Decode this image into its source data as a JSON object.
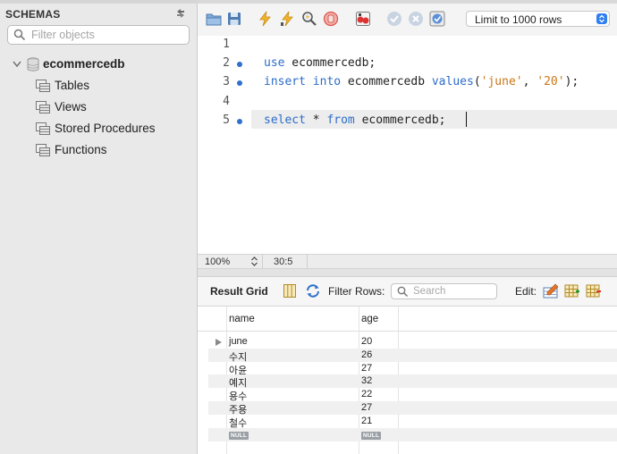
{
  "schemas": {
    "title": "SCHEMAS",
    "filter_placeholder": "Filter objects",
    "database": "ecommercedb",
    "items": [
      {
        "label": "Tables"
      },
      {
        "label": "Views"
      },
      {
        "label": "Stored Procedures"
      },
      {
        "label": "Functions"
      }
    ]
  },
  "toolbar": {
    "icons": [
      "open-folder-icon",
      "save-icon",
      "execute-icon",
      "execute-current-icon",
      "explain-icon",
      "stop-icon",
      "toggle-error-icon",
      "commit-icon",
      "rollback-icon",
      "autocommit-icon"
    ],
    "limit_label": "Limit to 1000 rows"
  },
  "editor": {
    "lines": [
      {
        "num": "1",
        "marker": false,
        "tokens": []
      },
      {
        "num": "2",
        "marker": true,
        "tokens": [
          {
            "t": "use",
            "k": "kw"
          },
          {
            "t": " ecommercedb;",
            "k": ""
          }
        ]
      },
      {
        "num": "3",
        "marker": true,
        "tokens": [
          {
            "t": "insert",
            "k": "kw"
          },
          {
            "t": " ",
            "k": ""
          },
          {
            "t": "into",
            "k": "kw"
          },
          {
            "t": " ecommercedb ",
            "k": ""
          },
          {
            "t": "values",
            "k": "kw"
          },
          {
            "t": "(",
            "k": ""
          },
          {
            "t": "'june'",
            "k": "str"
          },
          {
            "t": ", ",
            "k": ""
          },
          {
            "t": "'20'",
            "k": "str"
          },
          {
            "t": ");",
            "k": ""
          }
        ]
      },
      {
        "num": "4",
        "marker": false,
        "tokens": []
      },
      {
        "num": "5",
        "marker": true,
        "tokens": [
          {
            "t": "select",
            "k": "kw"
          },
          {
            "t": " * ",
            "k": ""
          },
          {
            "t": "from",
            "k": "kw"
          },
          {
            "t": " ecommercedb;",
            "k": ""
          }
        ]
      }
    ]
  },
  "status": {
    "zoom": "100%",
    "position": "30:5"
  },
  "result": {
    "title": "Result Grid",
    "filter_label": "Filter Rows:",
    "search_placeholder": "Search",
    "edit_label": "Edit:",
    "columns": [
      "name",
      "age"
    ],
    "rows": [
      {
        "name": "june",
        "age": "20"
      },
      {
        "name": "수지",
        "age": "26"
      },
      {
        "name": "아윤",
        "age": "27"
      },
      {
        "name": "예지",
        "age": "32"
      },
      {
        "name": "용수",
        "age": "22"
      },
      {
        "name": "주용",
        "age": "27"
      },
      {
        "name": "철수",
        "age": "21"
      }
    ],
    "null_label": "NULL"
  }
}
